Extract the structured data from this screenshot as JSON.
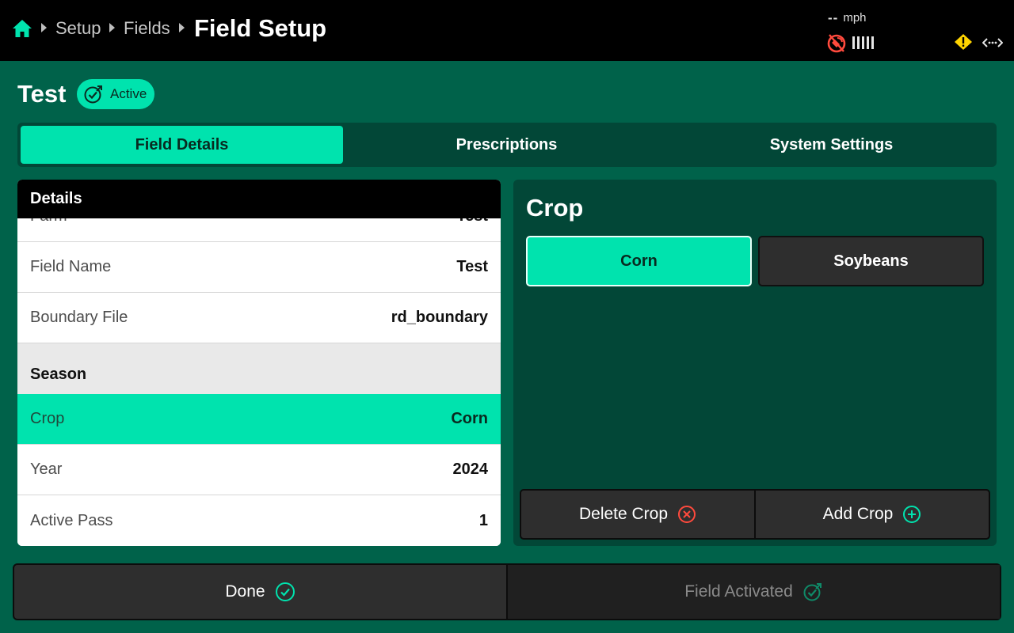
{
  "topbar": {
    "breadcrumbs": [
      "Setup",
      "Fields"
    ],
    "title": "Field Setup",
    "speed_value": "--",
    "speed_unit": "mph"
  },
  "header": {
    "field_name": "Test",
    "status_badge": "Active"
  },
  "tabs": [
    {
      "label": "Field Details",
      "selected": true
    },
    {
      "label": "Prescriptions",
      "selected": false
    },
    {
      "label": "System Settings",
      "selected": false
    }
  ],
  "details": {
    "title": "Details",
    "rows": [
      {
        "label": "Farm",
        "value": "Test"
      },
      {
        "label": "Field Name",
        "value": "Test"
      },
      {
        "label": "Boundary File",
        "value": "rd_boundary"
      }
    ],
    "season_title": "Season",
    "season_rows": [
      {
        "label": "Crop",
        "value": "Corn",
        "selected": true
      },
      {
        "label": "Year",
        "value": "2024"
      },
      {
        "label": "Active Pass",
        "value": "1"
      }
    ]
  },
  "crop_panel": {
    "title": "Crop",
    "options": [
      {
        "label": "Corn",
        "selected": true
      },
      {
        "label": "Soybeans",
        "selected": false
      }
    ],
    "delete_label": "Delete Crop",
    "add_label": "Add Crop"
  },
  "bottom": {
    "done_label": "Done",
    "activated_label": "Field Activated"
  },
  "colors": {
    "accent": "#00e3ae",
    "background": "#00624a",
    "panel": "#024737",
    "warning": "#ffd400",
    "error": "#ff4a3d"
  },
  "icons": [
    "home-icon",
    "gps-icon",
    "signal-bars-icon",
    "warning-icon",
    "connection-icon",
    "active-check-icon",
    "delete-x-icon",
    "add-plus-icon",
    "check-circle-icon"
  ]
}
